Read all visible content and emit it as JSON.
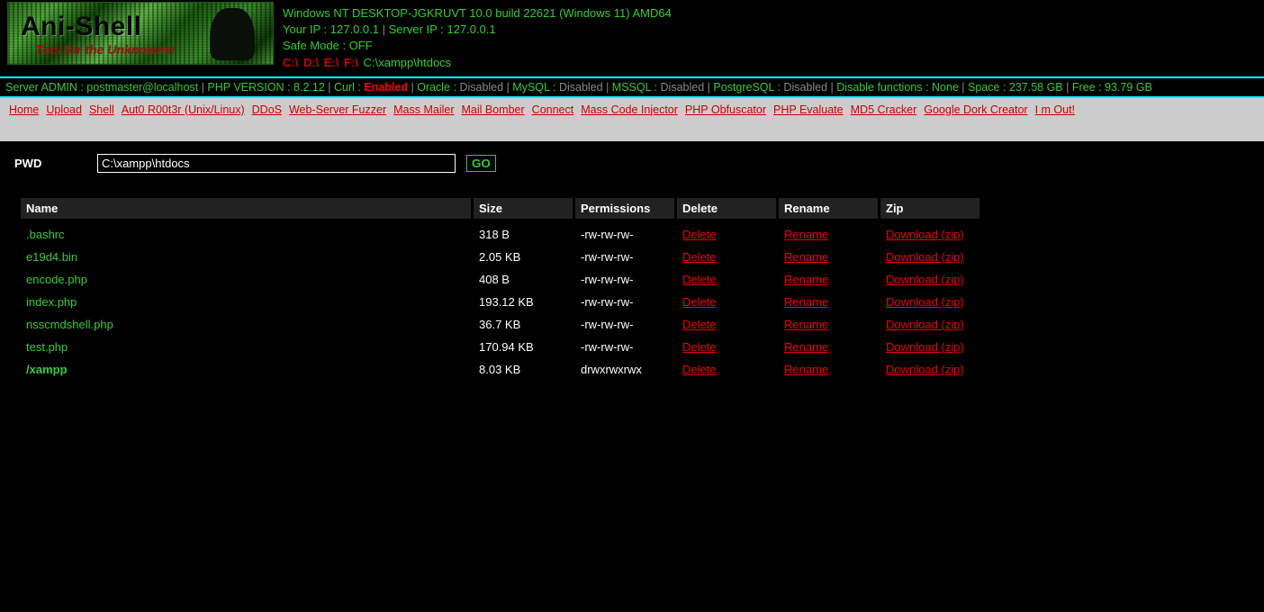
{
  "logo": {
    "title": "Ani-Shell",
    "subtitle": "Tool for the Unknowns!"
  },
  "sysinfo": {
    "os_line": "Windows NT DESKTOP-JGKRUVT 10.0 build 22621 (Windows 11) AMD64",
    "your_ip_label": "Your IP : ",
    "your_ip": "127.0.0.1",
    "server_ip_label": "Server IP : ",
    "server_ip": "127.0.0.1",
    "safe_mode": "Safe Mode : OFF",
    "cwd": "C:\\xampp\\htdocs"
  },
  "drives": [
    "C:\\",
    "D:\\",
    "E:\\",
    "F:\\"
  ],
  "status": {
    "admin_label": "Server ADMIN : ",
    "admin": "postmaster@localhost",
    "php_label": "PHP VERSION : ",
    "php": "8.2.12",
    "curl_label": "Curl : ",
    "curl": "Enabled",
    "oracle_label": "Oracle : ",
    "oracle": "Disabled",
    "mysql_label": "MySQL : ",
    "mysql": "Disabled",
    "mssql_label": "MSSQL : ",
    "mssql": "Disabled",
    "pgsql_label": "PostgreSQL : ",
    "pgsql": "Disabled",
    "disfn_label": "Disable functions : ",
    "disfn": "None",
    "space_label": "Space : ",
    "space": "237.58 GB",
    "free_label": "Free : ",
    "free": "93.79 GB"
  },
  "menu": [
    "Home",
    "Upload",
    "Shell",
    "Aut0 R00t3r (Unix/Linux)",
    "DDoS",
    "Web-Server Fuzzer",
    "Mass Mailer",
    "Mail Bomber",
    "Connect",
    "Mass Code Injector",
    "PHP Obfuscator",
    "PHP Evaluate",
    "MD5 Cracker",
    "Google Dork Creator",
    "I m Out!"
  ],
  "pwd": {
    "label": "PWD",
    "value": "C:\\xampp\\htdocs",
    "go": "GO"
  },
  "cols": {
    "name": "Name",
    "size": "Size",
    "perm": "Permissions",
    "del": "Delete",
    "ren": "Rename",
    "zip": "Zip"
  },
  "actions": {
    "delete": "Delete",
    "rename": "Rename",
    "zip": "Download (zip)"
  },
  "files": [
    {
      "name": ".bashrc",
      "size": "318 B",
      "perm": "-rw-rw-rw-",
      "is_dir": false
    },
    {
      "name": "e19d4.bin",
      "size": "2.05 KB",
      "perm": "-rw-rw-rw-",
      "is_dir": false
    },
    {
      "name": "encode.php",
      "size": "408 B",
      "perm": "-rw-rw-rw-",
      "is_dir": false
    },
    {
      "name": "index.php",
      "size": "193.12 KB",
      "perm": "-rw-rw-rw-",
      "is_dir": false
    },
    {
      "name": "nsscmdshell.php",
      "size": "36.7 KB",
      "perm": "-rw-rw-rw-",
      "is_dir": false
    },
    {
      "name": "test.php",
      "size": "170.94 KB",
      "perm": "-rw-rw-rw-",
      "is_dir": false
    },
    {
      "name": "/xampp",
      "size": "8.03 KB",
      "perm": "drwxrwxrwx",
      "is_dir": true
    }
  ]
}
